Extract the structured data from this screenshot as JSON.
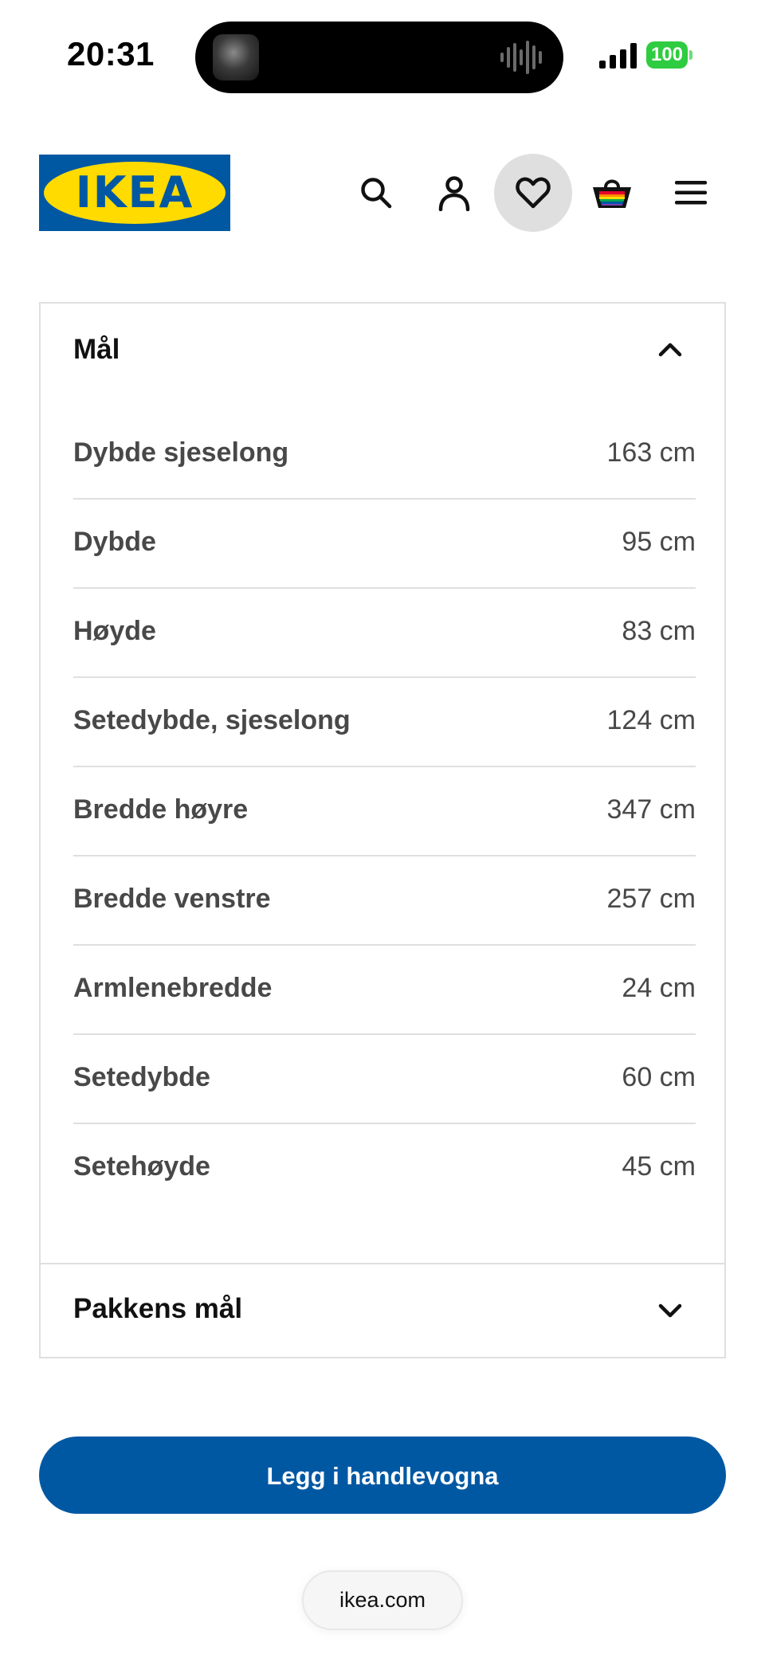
{
  "status_bar": {
    "time": "20:31",
    "battery": "100",
    "battery_color": "#2ecc40"
  },
  "header": {
    "logo_text": "IKEA",
    "brand_blue": "#0058a3",
    "brand_yellow": "#ffdb00",
    "icons": [
      "search-icon",
      "account-icon",
      "heart-icon",
      "cart-basket-icon",
      "menu-icon"
    ],
    "active_icon": "heart-icon"
  },
  "dimensions": {
    "title": "Mål",
    "expanded": true,
    "rows": [
      {
        "label": "Dybde sjeselong",
        "value": "163 cm"
      },
      {
        "label": "Dybde",
        "value": "95 cm"
      },
      {
        "label": "Høyde",
        "value": "83 cm"
      },
      {
        "label": "Setedybde, sjeselong",
        "value": "124 cm"
      },
      {
        "label": "Bredde høyre",
        "value": "347 cm"
      },
      {
        "label": "Bredde venstre",
        "value": "257 cm"
      },
      {
        "label": "Armlenebredde",
        "value": "24 cm"
      },
      {
        "label": "Setedybde",
        "value": "60 cm"
      },
      {
        "label": "Setehøyde",
        "value": "45 cm"
      }
    ]
  },
  "package": {
    "title": "Pakkens mål",
    "expanded": false
  },
  "cart": {
    "button_label": "Legg i handlevogna"
  },
  "browser": {
    "url": "ikea.com"
  }
}
